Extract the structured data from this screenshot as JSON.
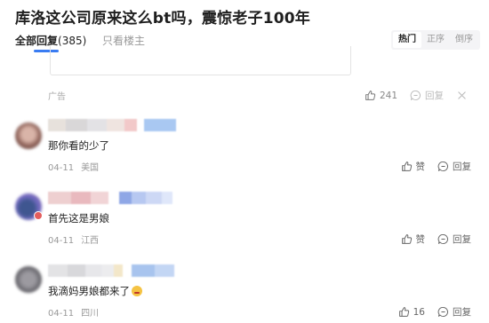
{
  "header": {
    "title": "库洛这公司原来这么bt吗，震惊老子100年"
  },
  "tabs": {
    "all_label": "全部回复",
    "all_count": "(385)",
    "op_only": "只看楼主"
  },
  "sort": [
    "热门",
    "正序",
    "倒序"
  ],
  "ad": {
    "label": "广告",
    "like_count": "241",
    "reply_label": "回复"
  },
  "comments": [
    {
      "text": "那你看的少了",
      "date": "04-11",
      "location": "美国",
      "like_label": "赞",
      "reply_label": "回复"
    },
    {
      "text": "首先这是男娘",
      "date": "04-11",
      "location": "江西",
      "like_label": "赞",
      "reply_label": "回复"
    },
    {
      "text": "我滴妈男娘都来了",
      "date": "04-11",
      "location": "四川",
      "like_label": "16",
      "reply_label": "回复"
    }
  ],
  "colors": {
    "accent": "#3a7cf2"
  }
}
